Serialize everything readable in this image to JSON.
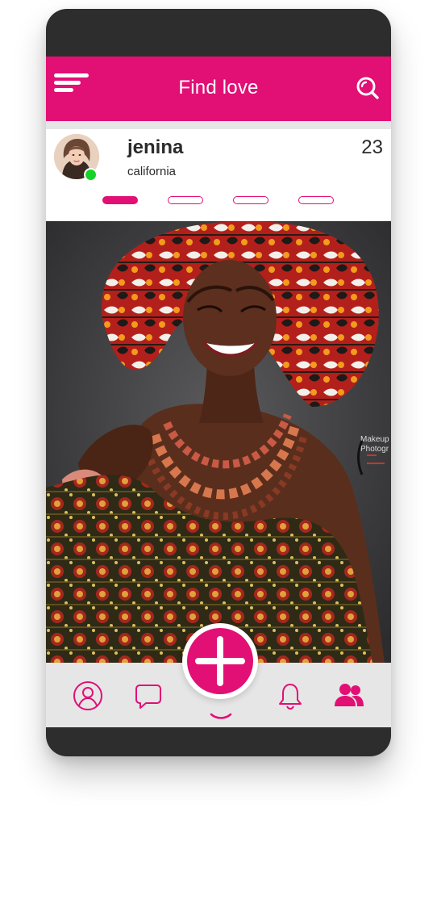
{
  "app": {
    "title": "Find love",
    "accent_color": "#e20f75",
    "online_color": "#16d32a"
  },
  "header": {
    "menu_icon": "menu-icon",
    "title": "Find love",
    "search_icon": "search-icon"
  },
  "profile": {
    "name": "jenina",
    "location": "california",
    "age": "23",
    "online": true,
    "avatar": "avatar",
    "photo_count": 4,
    "active_photo_index": 0
  },
  "photo": {
    "subject": "profile-photo",
    "watermark_lines": [
      "Makeup",
      "Photogr"
    ]
  },
  "bottom_nav": {
    "items": [
      {
        "name": "profile",
        "icon": "user-circle-icon"
      },
      {
        "name": "messages",
        "icon": "chat-bubble-icon"
      },
      {
        "name": "add",
        "icon": "plus-icon"
      },
      {
        "name": "notifications",
        "icon": "bell-icon"
      },
      {
        "name": "friends",
        "icon": "users-icon"
      }
    ]
  }
}
